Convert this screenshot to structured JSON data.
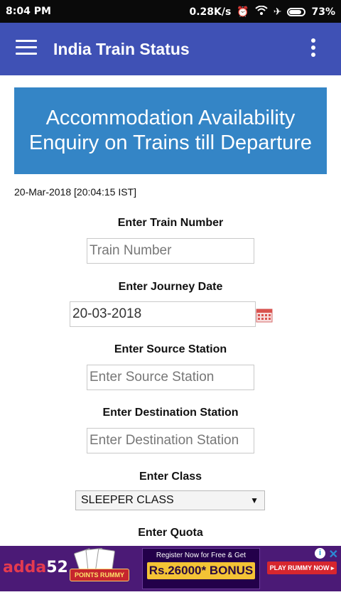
{
  "status_bar": {
    "time": "8:04 PM",
    "network_speed": "0.28K/s",
    "battery": "73%"
  },
  "app_bar": {
    "title": "India Train Status"
  },
  "banner": {
    "text": "Accommodation Availability Enquiry on Trains till Departure"
  },
  "timestamp": "20-Mar-2018 [20:04:15 IST]",
  "form": {
    "train_number": {
      "label": "Enter Train Number",
      "placeholder": "Train Number",
      "value": ""
    },
    "journey_date": {
      "label": "Enter Journey Date",
      "value": "20-03-2018"
    },
    "source_station": {
      "label": "Enter Source Station",
      "placeholder": "Enter Source Station",
      "value": ""
    },
    "destination_station": {
      "label": "Enter Destination Station",
      "placeholder": "Enter Destination Station",
      "value": ""
    },
    "class": {
      "label": "Enter Class",
      "selected": "SLEEPER CLASS"
    },
    "quota": {
      "label": "Enter Quota"
    }
  },
  "ad": {
    "brand": "adda",
    "brand_number": "52",
    "badge": "POINTS RUMMY",
    "register_text": "Register Now for Free & Get",
    "bonus_text": "Rs.26000* BONUS",
    "cta": "PLAY RUMMY NOW ▸",
    "close": "✕",
    "info": "i"
  },
  "colors": {
    "app_bar": "#3f51b5",
    "banner": "#3485c6",
    "status_bar": "#0a0a0a",
    "ad_bg": "#4b1a76"
  },
  "icons": [
    "menu-icon",
    "more-vert-icon",
    "calendar-icon",
    "alarm-icon",
    "wifi-icon",
    "airplane-icon",
    "battery-icon"
  ]
}
